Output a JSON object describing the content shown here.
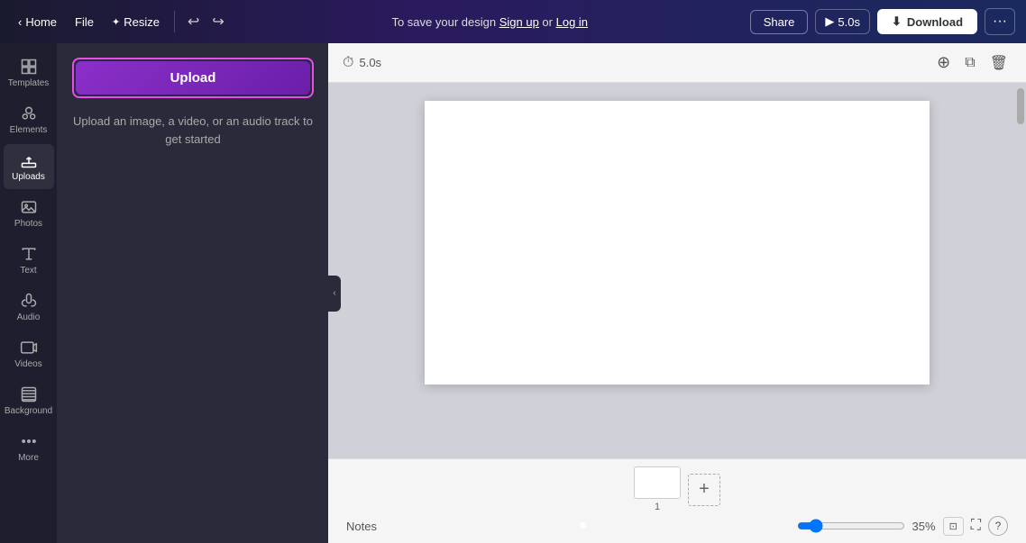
{
  "topnav": {
    "home_label": "Home",
    "file_label": "File",
    "resize_label": "Resize",
    "save_hint": "To save your design",
    "signup_label": "Sign up",
    "or_label": "or",
    "login_label": "Log in",
    "share_label": "Share",
    "play_duration": "5.0s",
    "download_label": "Download",
    "more_icon": "···"
  },
  "sidebar": {
    "items": [
      {
        "id": "templates",
        "label": "Templates"
      },
      {
        "id": "elements",
        "label": "Elements"
      },
      {
        "id": "uploads",
        "label": "Uploads"
      },
      {
        "id": "photos",
        "label": "Photos"
      },
      {
        "id": "text",
        "label": "Text"
      },
      {
        "id": "audio",
        "label": "Audio"
      },
      {
        "id": "videos",
        "label": "Videos"
      },
      {
        "id": "background",
        "label": "Background"
      },
      {
        "id": "more",
        "label": "More"
      }
    ]
  },
  "panel": {
    "upload_btn_label": "Upload",
    "upload_hint": "Upload an image, a video, or an audio track to get started"
  },
  "canvas": {
    "duration": "5.0s",
    "zoom_percent": "35%"
  },
  "pages": {
    "add_icon": "+",
    "page_number": "1"
  },
  "bottombar": {
    "notes_label": "Notes",
    "zoom_percent": "35%",
    "help_label": "?"
  }
}
